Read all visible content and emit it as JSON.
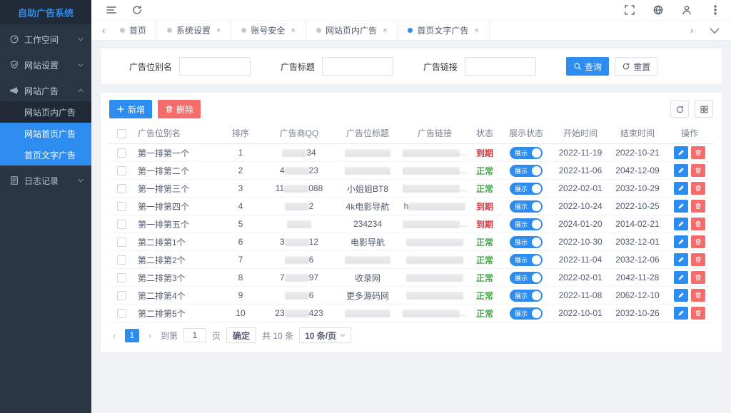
{
  "colors": {
    "accent": "#2d8cf0",
    "danger": "#f56c6c",
    "status_expired": "#d9363e",
    "status_normal": "#42a948",
    "sidebar_bg": "#293543"
  },
  "sidebar": {
    "title": "自助广告系统",
    "items": [
      {
        "label": "工作空间",
        "icon": "workspace-icon",
        "expanded": false
      },
      {
        "label": "网站设置",
        "icon": "site-settings-icon",
        "expanded": false
      },
      {
        "label": "网站广告",
        "icon": "site-ads-icon",
        "expanded": true,
        "children": [
          {
            "label": "网站页内广告",
            "active": false
          },
          {
            "label": "网站首页广告",
            "active": true
          },
          {
            "label": "首页文字广告",
            "active": true
          }
        ]
      },
      {
        "label": "日志记录",
        "icon": "logs-icon",
        "expanded": false
      }
    ]
  },
  "tabs": [
    {
      "label": "首页",
      "closable": false,
      "active": false
    },
    {
      "label": "系统设置",
      "closable": true,
      "active": false
    },
    {
      "label": "账号安全",
      "closable": true,
      "active": false
    },
    {
      "label": "网站页内广告",
      "closable": true,
      "active": false
    },
    {
      "label": "首页文字广告",
      "closable": true,
      "active": true
    }
  ],
  "search": {
    "fields": [
      {
        "label": "广告位别名",
        "value": "",
        "placeholder": ""
      },
      {
        "label": "广告标题",
        "value": "",
        "placeholder": ""
      },
      {
        "label": "广告链接",
        "value": "",
        "placeholder": ""
      }
    ],
    "query_label": "查询",
    "reset_label": "重置"
  },
  "toolbar": {
    "add_label": "新增",
    "delete_label": "删除"
  },
  "table": {
    "headers": [
      "广告位别名",
      "排序",
      "广告商QQ",
      "广告位标题",
      "广告链接",
      "状态",
      "展示状态",
      "开始时间",
      "结束时间",
      "操作"
    ],
    "rows": [
      {
        "alias": "第一排第一个",
        "sort": "1",
        "qq": {
          "prefix": "",
          "suffix": "34",
          "blur": true
        },
        "title": {
          "text": "",
          "blur": true
        },
        "link": {
          "prefix": "",
          "blur": true,
          "ellipsis": true
        },
        "status": {
          "text": "到期",
          "type": "expired"
        },
        "toggle": "展示",
        "start": "2022-11-19",
        "end": "2022-10-21"
      },
      {
        "alias": "第一排第二个",
        "sort": "2",
        "qq": {
          "prefix": "4",
          "suffix": "23",
          "blur": true
        },
        "title": {
          "text": "",
          "blur": true
        },
        "link": {
          "prefix": "",
          "blur": true,
          "ellipsis": true
        },
        "status": {
          "text": "正常",
          "type": "normal"
        },
        "toggle": "展示",
        "start": "2022-11-06",
        "end": "2042-12-09"
      },
      {
        "alias": "第一排第三个",
        "sort": "3",
        "qq": {
          "prefix": "11",
          "suffix": "088",
          "blur": true
        },
        "title": {
          "text": "小姐姐BT8",
          "blur": false
        },
        "link": {
          "prefix": "",
          "blur": true,
          "ellipsis": true
        },
        "status": {
          "text": "正常",
          "type": "normal"
        },
        "toggle": "展示",
        "start": "2022-02-01",
        "end": "2032-10-29"
      },
      {
        "alias": "第一排第四个",
        "sort": "4",
        "qq": {
          "prefix": "",
          "suffix": "2",
          "blur": true
        },
        "title": {
          "text": "4k电影导航",
          "blur": false
        },
        "link": {
          "prefix": "h",
          "blur": true,
          "ellipsis": false
        },
        "status": {
          "text": "到期",
          "type": "expired"
        },
        "toggle": "展示",
        "start": "2022-10-24",
        "end": "2022-10-25"
      },
      {
        "alias": "第一排第五个",
        "sort": "5",
        "qq": {
          "prefix": "",
          "suffix": "",
          "blur": true
        },
        "title": {
          "text": "234234",
          "blur": false
        },
        "link": {
          "prefix": "",
          "blur": true,
          "ellipsis": true
        },
        "status": {
          "text": "到期",
          "type": "expired"
        },
        "toggle": "展示",
        "start": "2024-01-20",
        "end": "2014-02-21"
      },
      {
        "alias": "第二排第1个",
        "sort": "6",
        "qq": {
          "prefix": "3",
          "suffix": "12",
          "blur": true
        },
        "title": {
          "text": "电影导航",
          "blur": false
        },
        "link": {
          "prefix": "",
          "blur": true,
          "ellipsis": false
        },
        "status": {
          "text": "正常",
          "type": "normal"
        },
        "toggle": "展示",
        "start": "2022-10-30",
        "end": "2032-12-01"
      },
      {
        "alias": "第二排第2个",
        "sort": "7",
        "qq": {
          "prefix": "",
          "suffix": "6",
          "blur": true
        },
        "title": {
          "text": "",
          "blur": true
        },
        "link": {
          "prefix": "",
          "blur": true,
          "ellipsis": false
        },
        "status": {
          "text": "正常",
          "type": "normal"
        },
        "toggle": "展示",
        "start": "2022-11-04",
        "end": "2032-12-06"
      },
      {
        "alias": "第二排第3个",
        "sort": "8",
        "qq": {
          "prefix": "7",
          "suffix": "97",
          "blur": true
        },
        "title": {
          "text": "收录网",
          "blur": false
        },
        "link": {
          "prefix": "",
          "blur": true,
          "ellipsis": false
        },
        "status": {
          "text": "正常",
          "type": "normal"
        },
        "toggle": "展示",
        "start": "2022-02-01",
        "end": "2042-11-28"
      },
      {
        "alias": "第二排第4个",
        "sort": "9",
        "qq": {
          "prefix": "",
          "suffix": "6",
          "blur": true
        },
        "title": {
          "text": "更多源码网",
          "blur": false
        },
        "link": {
          "prefix": "",
          "blur": true,
          "ellipsis": false
        },
        "status": {
          "text": "正常",
          "type": "normal"
        },
        "toggle": "展示",
        "start": "2022-11-08",
        "end": "2062-12-10"
      },
      {
        "alias": "第二排第5个",
        "sort": "10",
        "qq": {
          "prefix": "23",
          "suffix": "423",
          "blur": true
        },
        "title": {
          "text": "",
          "blur": true
        },
        "link": {
          "prefix": "",
          "blur": true,
          "ellipsis": true
        },
        "status": {
          "text": "正常",
          "type": "normal"
        },
        "toggle": "展示",
        "start": "2022-10-01",
        "end": "2032-10-26"
      }
    ]
  },
  "pagination": {
    "prev": "‹",
    "next": "›",
    "page": "1",
    "goto_label": "到第",
    "goto_value": "1",
    "page_unit": "页",
    "confirm_label": "确定",
    "total_label": "共 10 条",
    "page_size_label": "10 条/页"
  },
  "tabbar_nav": {
    "left": "‹",
    "right": "›"
  }
}
